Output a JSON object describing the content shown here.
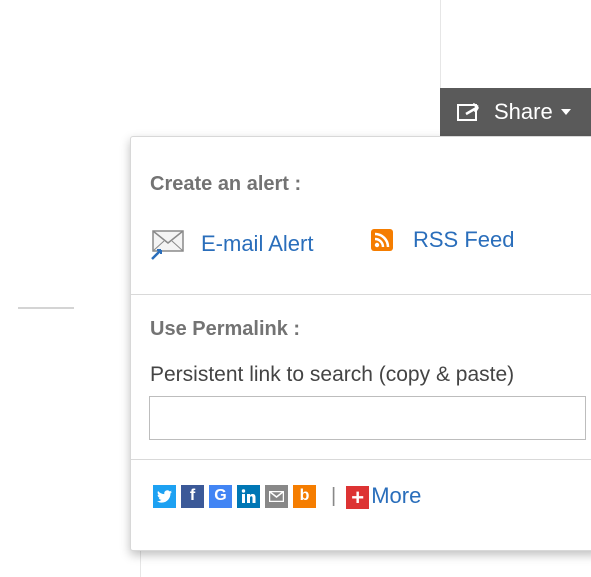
{
  "share": {
    "label": "Share"
  },
  "alert": {
    "title": "Create an alert :",
    "email_label": "E-mail Alert",
    "rss_label": "RSS Feed"
  },
  "permalink": {
    "title": "Use Permalink :",
    "description": "Persistent link to search (copy & paste)",
    "value": ""
  },
  "social": {
    "icons": [
      "twitter-icon",
      "facebook-icon",
      "google-icon",
      "linkedin-icon",
      "email-icon",
      "blogger-icon"
    ],
    "separator": "|",
    "more_label": "More"
  },
  "colors": {
    "share_bg": "#5a5a5a",
    "link": "#2a6ebb",
    "twitter": "#1da1f2",
    "facebook": "#3b5998",
    "google": "#4285f4",
    "linkedin": "#0077b5",
    "email": "#888888",
    "blogger": "#f57d00",
    "plus": "#dd3333"
  }
}
